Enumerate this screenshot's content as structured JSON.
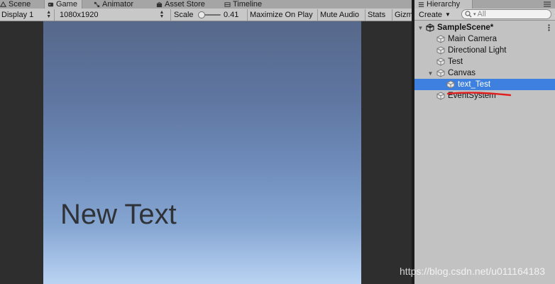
{
  "game_tabs": [
    {
      "label": "Scene",
      "icon": "scene-icon"
    },
    {
      "label": "Game",
      "icon": "game-icon"
    },
    {
      "label": "Animator",
      "icon": "animator-icon"
    },
    {
      "label": "Asset Store",
      "icon": "asset-store-icon"
    },
    {
      "label": "Timeline",
      "icon": "timeline-icon"
    }
  ],
  "game_toolbar": {
    "display": "Display 1",
    "resolution": "1080x1920",
    "scale_label": "Scale",
    "scale_value": "0.41",
    "maximize": "Maximize On Play",
    "mute": "Mute Audio",
    "stats": "Stats",
    "gizmos": "Gizm"
  },
  "viewport": {
    "text": "New Text"
  },
  "hierarchy": {
    "tab_label": "Hierarchy",
    "create_label": "Create",
    "search_placeholder": "All",
    "scene_name": "SampleScene*",
    "items": [
      {
        "label": "Main Camera"
      },
      {
        "label": "Directional Light"
      },
      {
        "label": "Test"
      },
      {
        "label": "Canvas"
      },
      {
        "label": "text_Test"
      },
      {
        "label": "EventSystem"
      }
    ]
  },
  "watermark": "https://blog.csdn.net/u011164183",
  "colors": {
    "selection": "#3d80df",
    "annotation": "#e02020"
  }
}
